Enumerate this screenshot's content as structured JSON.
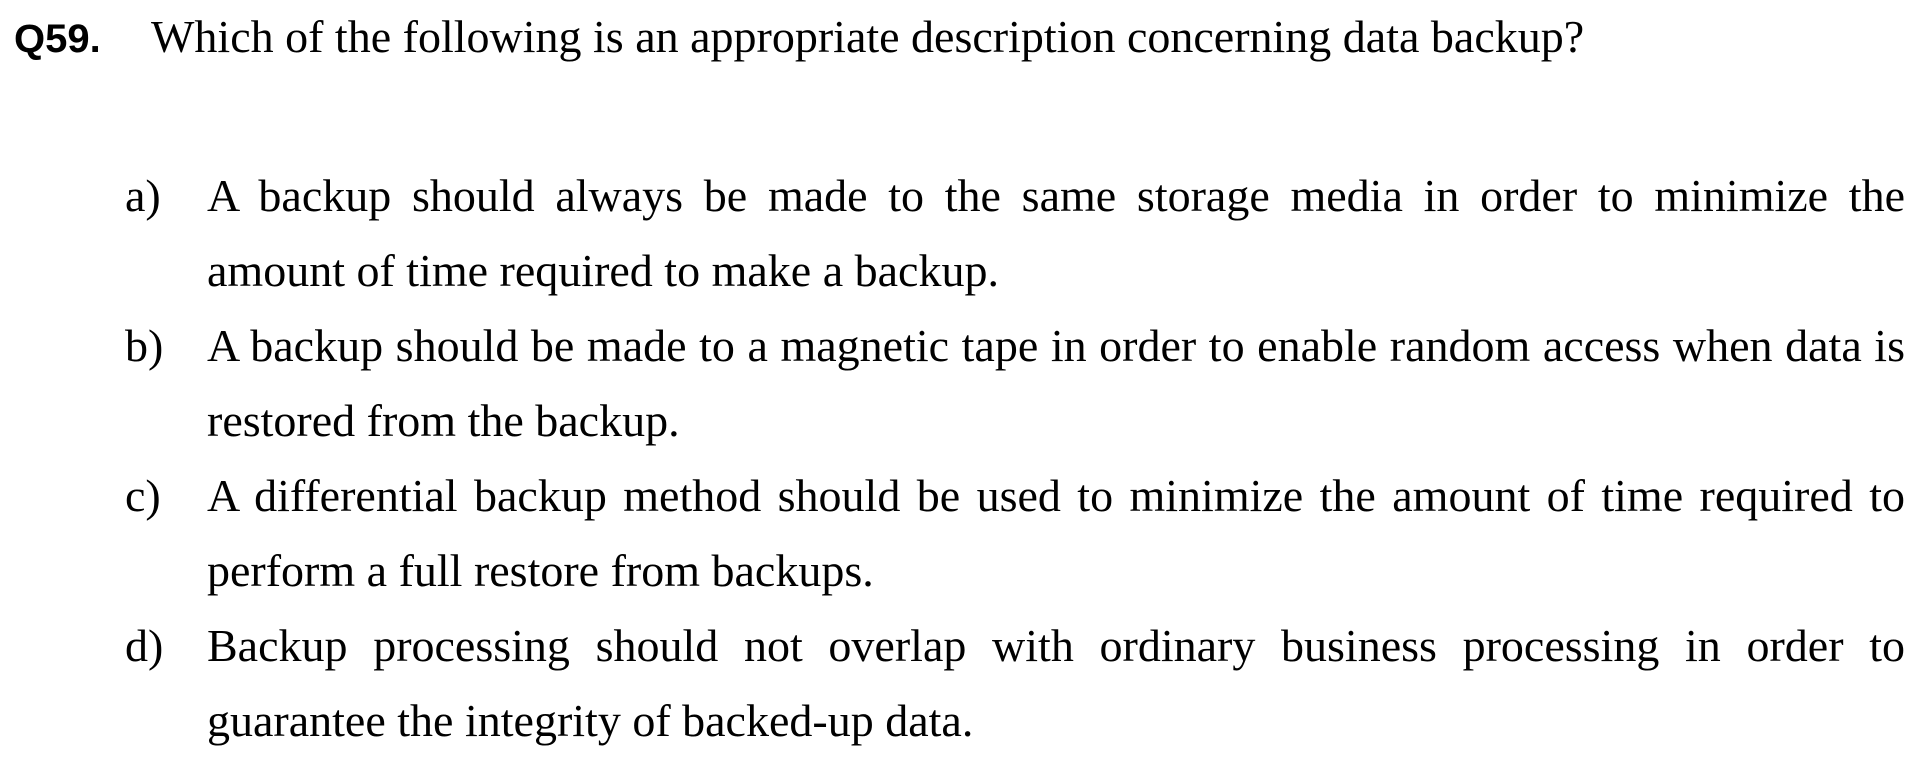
{
  "question": {
    "number": "Q59.",
    "text": "Which of the following is an appropriate description concerning data backup?"
  },
  "options": [
    {
      "label": "a)",
      "text": "A backup should always be made to the same storage media in order to minimize the amount of time required to make a backup."
    },
    {
      "label": "b)",
      "text": "A backup should be made to a magnetic tape in order to enable random access when data is restored from the backup."
    },
    {
      "label": "c)",
      "text": "A differential backup method should be used to minimize the amount of time required to perform a full restore from backups."
    },
    {
      "label": "d)",
      "text": "Backup processing should not overlap with ordinary business processing in order to guarantee the integrity of backed-up data."
    }
  ]
}
